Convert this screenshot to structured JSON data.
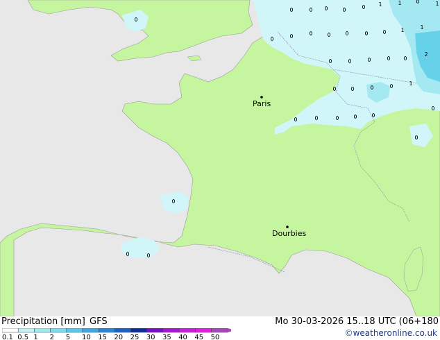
{
  "map": {
    "cities": [
      {
        "name": "Paris"
      },
      {
        "name": "Dourbies"
      }
    ],
    "values_shown": [
      "1",
      "1",
      "1",
      "1",
      "2",
      "1",
      "1"
    ]
  },
  "footer": {
    "title": "Precipitation [mm]",
    "model": "GFS",
    "datetime": "Mo 30-03-2026 15..18 UTC (06+180",
    "credit": "©weatheronline.co.uk"
  },
  "legend": {
    "labels": [
      "0.1",
      "0.5",
      "1",
      "2",
      "5",
      "10",
      "15",
      "20",
      "25",
      "30",
      "35",
      "40",
      "45",
      "50"
    ],
    "colors": [
      "#ffffff",
      "#c6f2f6",
      "#a2e9f1",
      "#7dddee",
      "#5ac8ea",
      "#41a8e2",
      "#2a84d8",
      "#1b5fc7",
      "#0f2e9b",
      "#7a10c8",
      "#a518d8",
      "#c81ee0",
      "#e21ee0",
      "#a64ab8"
    ]
  },
  "colors": {
    "land": "#c6f5a0",
    "sea": "#e8e8e8",
    "precip_light": "#d0f6fa",
    "precip_mid": "#a4e9f2",
    "precip_heavy": "#66d2ea"
  }
}
